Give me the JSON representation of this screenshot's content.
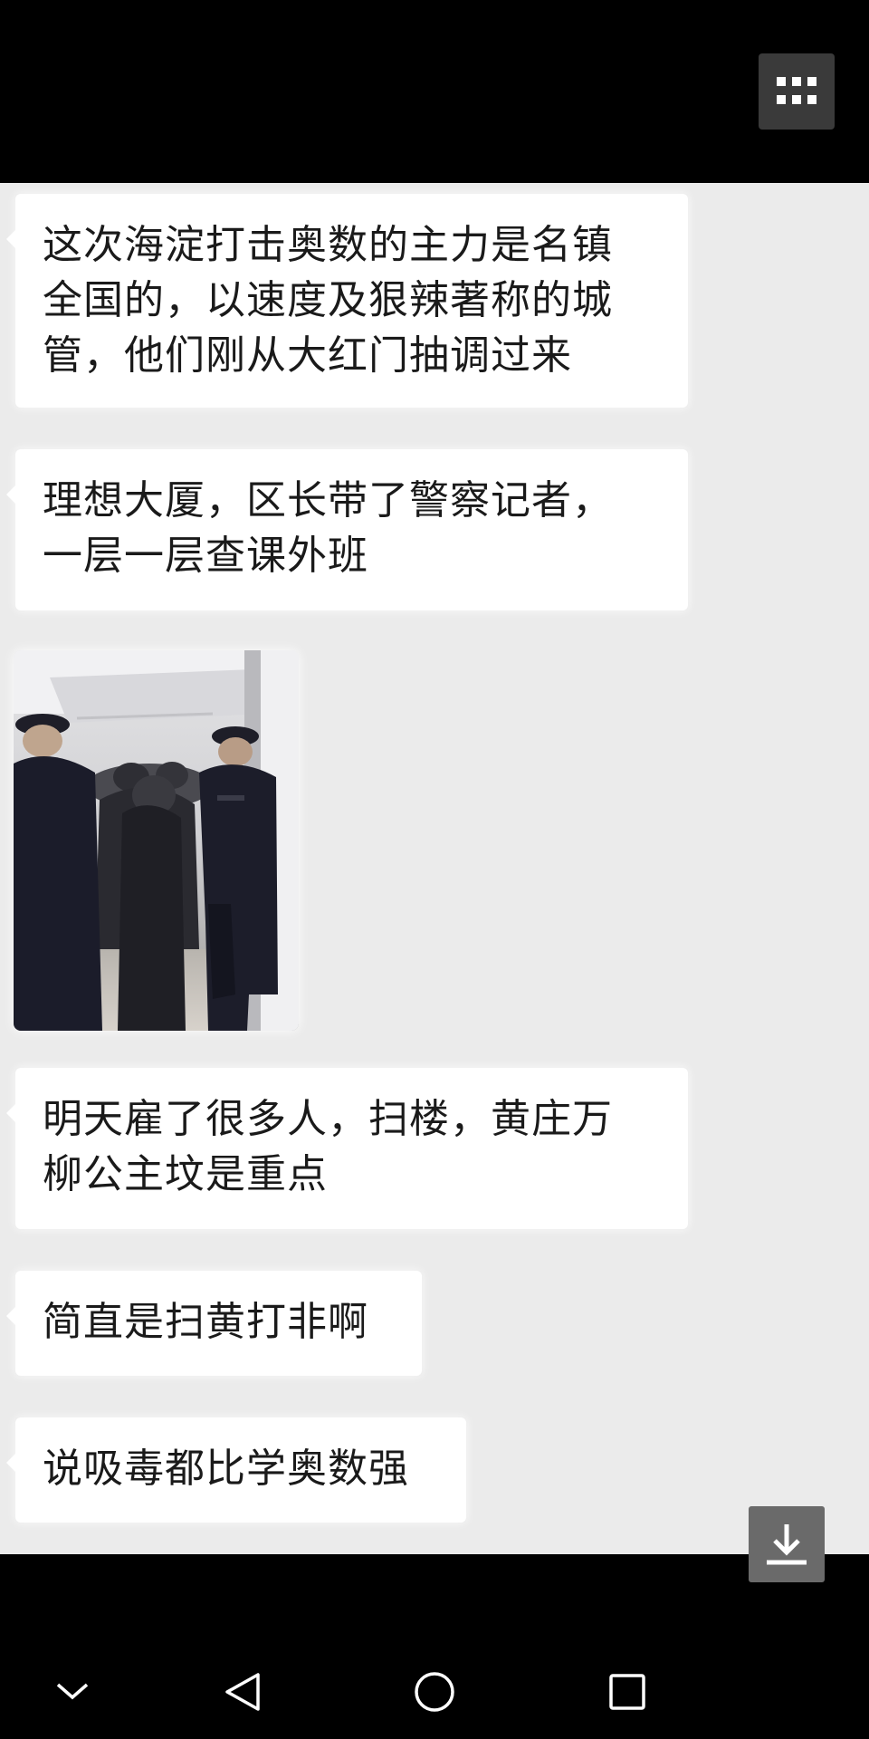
{
  "header": {
    "menu_icon": "grid-menu-icon"
  },
  "messages": [
    {
      "type": "text",
      "text": "这次海淀打击奥数的主力是名镇\n全国的，以速度及狠辣著称的城\n管，他们刚从大红门抽调过来"
    },
    {
      "type": "text",
      "text": "理想大厦，区长带了警察记者，\n一层一层查课外班"
    },
    {
      "type": "image",
      "icon": "photo-thumbnail"
    },
    {
      "type": "text",
      "text": "明天雇了很多人，扫楼，黄庄万\n柳公主坟是重点"
    },
    {
      "type": "text",
      "text": "简直是扫黄打非啊"
    },
    {
      "type": "text",
      "text": "说吸毒都比学奥数强"
    }
  ],
  "overlay": {
    "download_icon": "download-icon"
  },
  "nav": {
    "items": [
      "chevron-down-icon",
      "back-triangle-icon",
      "home-circle-icon",
      "recents-square-icon"
    ]
  },
  "colors": {
    "chat_background": "#ebebeb",
    "bubble_background": "#ffffff",
    "bar_background": "#000000"
  }
}
